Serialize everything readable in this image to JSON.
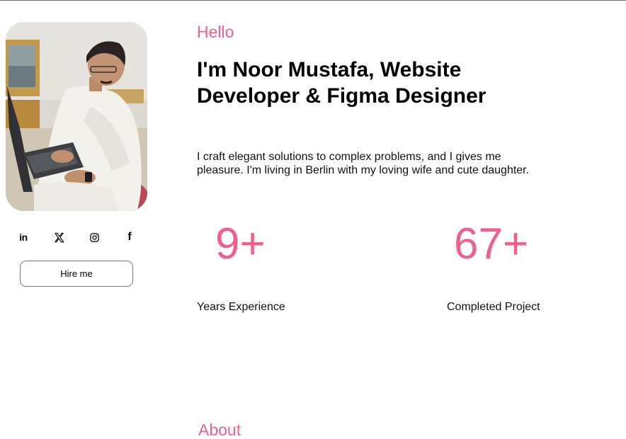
{
  "profile": {
    "photo_alt": "Noor Mustafa working on a laptop",
    "hire_label": "Hire me"
  },
  "socials": [
    {
      "name": "linkedin-icon",
      "glyph": "in"
    },
    {
      "name": "x-icon",
      "glyph": "X"
    },
    {
      "name": "instagram-icon",
      "glyph": "instagram"
    },
    {
      "name": "facebook-icon",
      "glyph": "f"
    }
  ],
  "hero": {
    "greeting": "Hello",
    "headline": "I'm Noor Mustafa, Website Developer & Figma Designer",
    "bio": "I craft elegant solutions to complex problems, and I gives me pleasure. I'm living in Berlin with my loving wife and cute daughter."
  },
  "stats": [
    {
      "value": "9+",
      "label": "Years Experience"
    },
    {
      "value": "67+",
      "label": "Completed Project"
    }
  ],
  "next_section": {
    "title": "About"
  },
  "colors": {
    "accent": "#f0608c",
    "text": "#000000",
    "border": "#7a7a7a"
  }
}
